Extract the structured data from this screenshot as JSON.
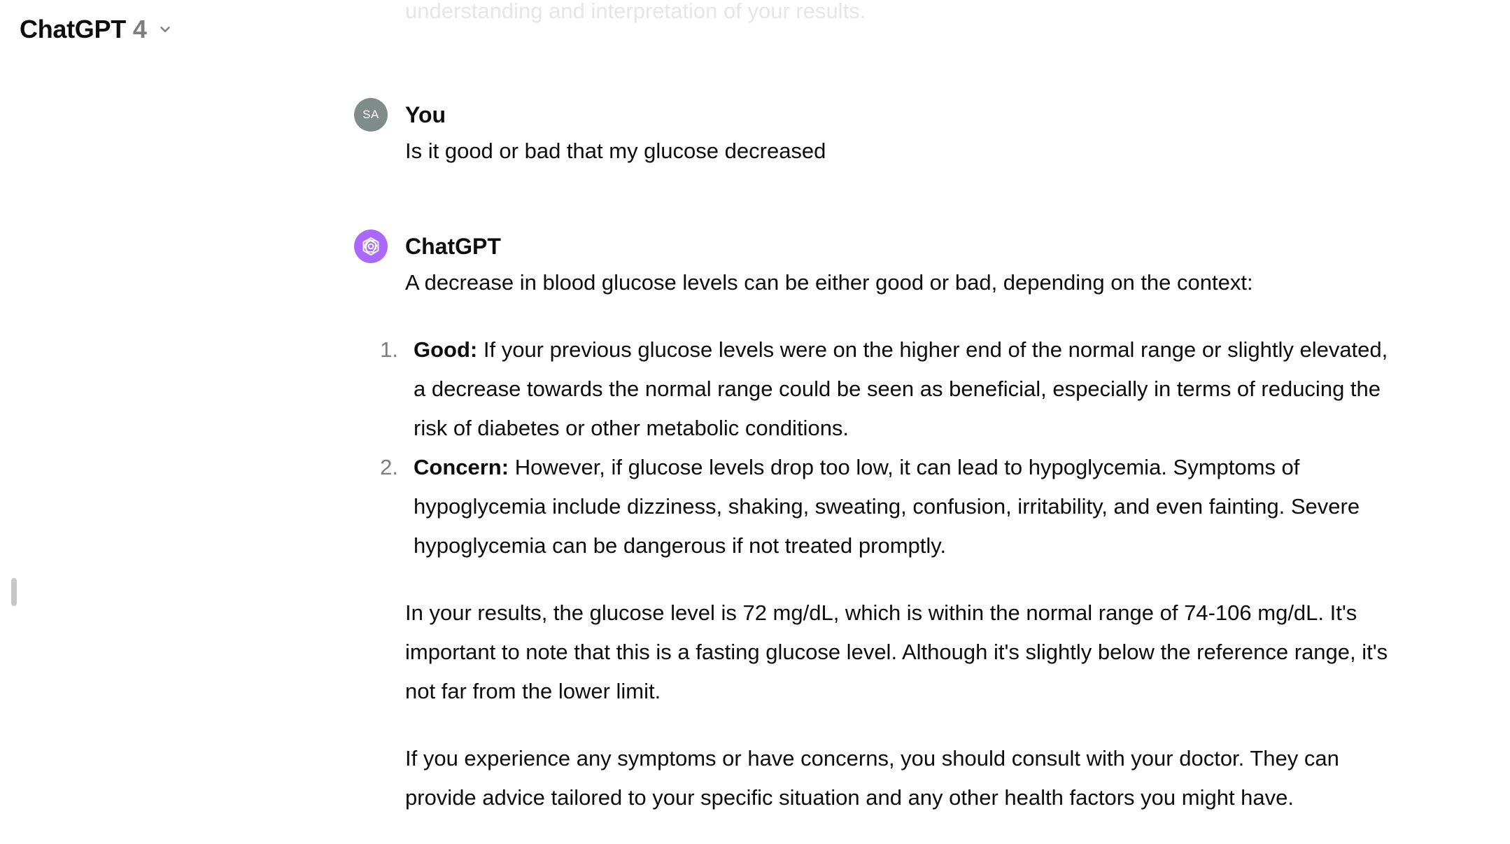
{
  "header": {
    "model_name": "ChatGPT",
    "model_version": "4",
    "chevron_icon": "chevron-down-icon"
  },
  "previous_text": "understanding and interpretation of your results.",
  "user_message": {
    "avatar_initials": "SA",
    "author": "You",
    "text": "Is it good or bad that my glucose decreased"
  },
  "assistant_message": {
    "author": "ChatGPT",
    "avatar_icon": "openai-logo-icon",
    "intro": "A decrease in blood glucose levels can be either good or bad, depending on the context:",
    "points": [
      {
        "number": "1.",
        "label": "Good:",
        "text": " If your previous glucose levels were on the higher end of the normal range or slightly elevated, a decrease towards the normal range could be seen as beneficial, especially in terms of reducing the risk of diabetes or other metabolic conditions."
      },
      {
        "number": "2.",
        "label": "Concern:",
        "text": " However, if glucose levels drop too low, it can lead to hypoglycemia. Symptoms of hypoglycemia include dizziness, shaking, sweating, confusion, irritability, and even fainting. Severe hypoglycemia can be dangerous if not treated promptly."
      }
    ],
    "paragraph_results": "In your results, the glucose level is 72 mg/dL, which is within the normal range of 74-106 mg/dL. It's important to note that this is a fasting glucose level. Although it's slightly below the reference range, it's not far from the lower limit.",
    "paragraph_advice": "If you experience any symptoms or have concerns, you should consult with your doctor. They can provide advice tailored to your specific situation and any other health factors you might have."
  },
  "colors": {
    "assistant_avatar": "#ab68ff",
    "user_avatar": "#7f8c8a",
    "text": "#0d0d0d",
    "muted": "#7d7d7d"
  }
}
